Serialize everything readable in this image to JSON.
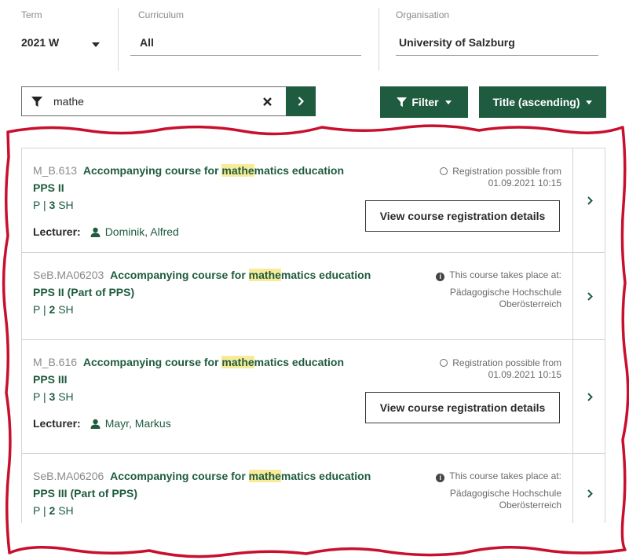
{
  "filters": {
    "term": {
      "label": "Term",
      "value": "2021 W"
    },
    "curriculum": {
      "label": "Curriculum",
      "value": "All"
    },
    "organisation": {
      "label": "Organisation",
      "value": "University of Salzburg"
    }
  },
  "search": {
    "value": "mathe"
  },
  "buttons": {
    "filter": "Filter",
    "sort": "Title (ascending)"
  },
  "courses": [
    {
      "code": "M_B.613",
      "title_pre": "Accompanying course for ",
      "title_hl": "mathe",
      "title_post": "matics education",
      "title_line2": "PPS II",
      "type": "P",
      "hours": "3",
      "unit": "SH",
      "info_line1": "Registration possible from",
      "info_line2": "01.09.2021 10:15",
      "button": "View course registration details",
      "lecturer_label": "Lecturer:",
      "lecturer": "Dominik, Alfred"
    },
    {
      "code": "SeB.MA06203",
      "title_pre": "Accompanying course for ",
      "title_hl": "mathe",
      "title_post": "matics education",
      "title_line2": "PPS II (Part of PPS)",
      "type": "P",
      "hours": "2",
      "unit": "SH",
      "info_line1": "This course takes place at:",
      "info_line2": "Pädagogische Hochschule",
      "info_line3": "Oberösterreich"
    },
    {
      "code": "M_B.616",
      "title_pre": "Accompanying course for ",
      "title_hl": "mathe",
      "title_post": "matics education",
      "title_line2": "PPS III",
      "type": "P",
      "hours": "3",
      "unit": "SH",
      "info_line1": "Registration possible from",
      "info_line2": "01.09.2021 10:15",
      "button": "View course registration details",
      "lecturer_label": "Lecturer:",
      "lecturer": "Mayr, Markus"
    },
    {
      "code": "SeB.MA06206",
      "title_pre": "Accompanying course for ",
      "title_hl": "mathe",
      "title_post": "matics education",
      "title_line2": "PPS III (Part of PPS)",
      "type": "P",
      "hours": "2",
      "unit": "SH",
      "info_line1": "This course takes place at:",
      "info_line2": "Pädagogische Hochschule",
      "info_line3": "Oberösterreich"
    }
  ],
  "colors": {
    "accent": "#1e5b3f",
    "highlight": "#f7eb9a",
    "annotation": "#c8102e"
  }
}
